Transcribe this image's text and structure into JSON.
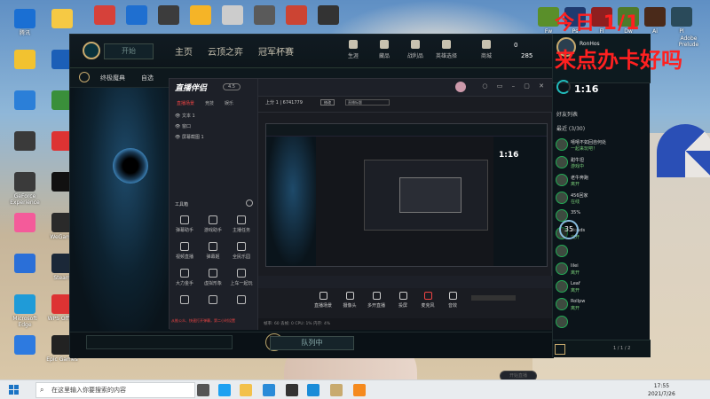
{
  "desktop": {
    "icons_left": [
      {
        "label": "腾讯",
        "color": "#1a6fd3"
      },
      {
        "label": "",
        "color": "#f2c230"
      },
      {
        "label": "",
        "color": "#2b7fd8"
      },
      {
        "label": "",
        "color": "#3a3a3a"
      },
      {
        "label": "GeForce Experience",
        "color": "#3a3a3a"
      },
      {
        "label": "",
        "color": "#f45b9a"
      },
      {
        "label": "",
        "color": "#2a6fd8"
      },
      {
        "label": "Microsoft Edge",
        "color": "#1f9bd8"
      },
      {
        "label": "",
        "color": "#2d7ae0"
      }
    ],
    "icons_left2": [
      {
        "label": "",
        "color": "#f6c944"
      },
      {
        "label": "",
        "color": "#1c5fb7"
      },
      {
        "label": "",
        "color": "#3a8f3a"
      },
      {
        "label": "",
        "color": "#d33"
      },
      {
        "label": "",
        "color": "#111"
      },
      {
        "label": "WeGame",
        "color": "#2a2a2a"
      },
      {
        "label": "Steam",
        "color": "#1b2838"
      },
      {
        "label": "WPS Office",
        "color": "#d33"
      },
      {
        "label": "Epic Games",
        "color": "#222"
      }
    ],
    "icons_top": [
      {
        "label": "",
        "color": "#d6413a"
      },
      {
        "label": "",
        "color": "#1f6fd0"
      },
      {
        "label": "",
        "color": "#3c3c3c"
      },
      {
        "label": "",
        "color": "#f5b427"
      },
      {
        "label": "",
        "color": "#ccc"
      },
      {
        "label": "",
        "color": "#5a5a5a"
      },
      {
        "label": "",
        "color": "#c43"
      },
      {
        "label": "",
        "color": "#333"
      }
    ],
    "icons_right": [
      {
        "label": "Fw",
        "color": "#5a8f2a"
      },
      {
        "label": "Ps",
        "color": "#1f3a6f"
      },
      {
        "label": "Fl",
        "color": "#8f1f1f"
      },
      {
        "label": "Dw",
        "color": "#4f7a2a"
      },
      {
        "label": "Ai",
        "color": "#4a2a1a"
      },
      {
        "label": "Pl",
        "color": "#2a4a5a"
      }
    ],
    "right_label": "Adobe Prelude"
  },
  "overlay": {
    "line1": "今日  1/1",
    "line2": "来点办卡好吗"
  },
  "lol": {
    "play_label": "开始",
    "tabs": [
      "主页",
      "云顶之弈",
      "冠军杯赛"
    ],
    "top_icons": [
      "生涯",
      "藏品",
      "战利品",
      "英雄选择",
      "商城"
    ],
    "currency_blue": "0",
    "currency_rp": "285",
    "sub_mode": "终极魔典",
    "sub_type": "自选",
    "queue_label": "队列中"
  },
  "stream": {
    "logo": "直播伴侣",
    "badge": "4.5",
    "tabs": [
      "直播场景",
      "竞技",
      "娱乐"
    ],
    "sources": [
      "文本 1",
      "窗口",
      "屏幕截图 1"
    ],
    "tools_heading": "工具箱",
    "tools": [
      [
        "弹幕助手",
        "游戏助手",
        "主播任务"
      ],
      [
        "视频直播",
        "弹幕姬",
        "全民乐园"
      ],
      [
        "大力金手",
        "虚拟形象",
        "上车一起玩"
      ],
      [
        "",
        "",
        ""
      ]
    ],
    "room_id": "6741779",
    "edit_label": "修改",
    "preview_title": "直播标题",
    "bottom_tools": [
      "直播场景",
      "摄像头",
      "多开直播",
      "投屏",
      "麦克风",
      "音效"
    ],
    "status": "帧率: 60  丢帧: 0  CPU: 1%  内存: 4%",
    "start_label": "开始直播",
    "footer_note": "从推公众、快速打开弹幕，第二小时设置"
  },
  "friends": {
    "name": "RonHos",
    "status": "生活上的朋友",
    "timer": "1:16",
    "section": "好友列表",
    "group": "最近 (3/30)",
    "list": [
      {
        "name": "嘻嘻不如回自何处",
        "status": "一起来玩吧！"
      },
      {
        "name": "甜牛坦",
        "status": "游戏中"
      },
      {
        "name": "老牛奔跑",
        "status": "离开"
      },
      {
        "name": "456回家",
        "status": "在线"
      },
      {
        "name": "35%",
        "status": ""
      },
      {
        "name": "clouds",
        "status": "离开"
      },
      {
        "name": "",
        "status": ""
      },
      {
        "name": "lilei",
        "status": "离开"
      },
      {
        "name": "Leaf",
        "status": "离开"
      },
      {
        "name": "Rollpw",
        "status": "离开"
      },
      {
        "name": "",
        "status": ""
      }
    ],
    "badge_value": "35",
    "chat_count": "1 / 1 / 2"
  },
  "taskbar": {
    "search_placeholder": "在这里输入你要搜索的内容",
    "time": "17:55",
    "date": "2021/7/26"
  }
}
